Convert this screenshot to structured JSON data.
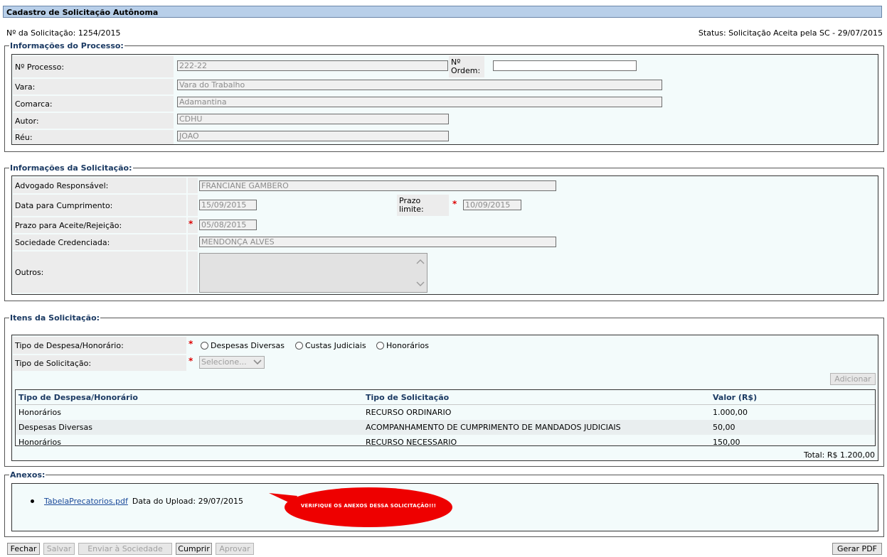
{
  "title": "Cadastro de Solicitação Autônoma",
  "header": {
    "solicitacao": "Nº da Solicitação: 1254/2015",
    "status": "Status: Solicitação Aceita pela SC - 29/07/2015"
  },
  "processo": {
    "legend": "Informações do Processo:",
    "fields": {
      "processo_label": "Nº Processo:",
      "processo_value": "222-22",
      "ordem_label_1": "Nº",
      "ordem_label_2": "Ordem:",
      "ordem_value": "",
      "vara_label": "Vara:",
      "vara_value": "Vara do Trabalho",
      "comarca_label": "Comarca:",
      "comarca_value": "Adamantina",
      "autor_label": "Autor:",
      "autor_value": "CDHU",
      "reu_label": "Réu:",
      "reu_value": "JOAO"
    }
  },
  "solicitacao": {
    "legend": "Informações da Solicitação:",
    "advogado_label": "Advogado Responsável:",
    "advogado_value": "FRANCIANE GAMBERO",
    "data_label": "Data para Cumprimento:",
    "data_value": "15/09/2015",
    "prazo_limite_label_1": "Prazo",
    "prazo_limite_label_2": "limite:",
    "prazo_limite_value": "10/09/2015",
    "prazo_aceite_label": "Prazo para Aceite/Rejeição:",
    "prazo_aceite_value": "05/08/2015",
    "sociedade_label": "Sociedade Credenciada:",
    "sociedade_value": "MENDONÇA ALVES",
    "outros_label": "Outros:",
    "outros_value": ""
  },
  "itens": {
    "legend": "Itens da Solicitação:",
    "tipo_despesa_label": "Tipo de Despesa/Honorário:",
    "radio_options": [
      "Despesas Diversas",
      "Custas Judiciais",
      "Honorários"
    ],
    "tipo_solicitacao_label": "Tipo de Solicitação:",
    "select_placeholder": "Selecione...",
    "adicionar_label": "Adicionar",
    "columns": [
      "Tipo de Despesa/Honorário",
      "Tipo de Solicitação",
      "Valor (R$)"
    ],
    "rows": [
      [
        "Honorários",
        "RECURSO ORDINARIO",
        "1.000,00"
      ],
      [
        "Despesas Diversas",
        "ACOMPANHAMENTO DE CUMPRIMENTO DE MANDADOS JUDICIAIS",
        "50,00"
      ],
      [
        "Honorários",
        "RECURSO NECESSARIO",
        "150,00"
      ]
    ],
    "total": "Total: R$ 1.200,00"
  },
  "anexos": {
    "legend": "Anexos:",
    "file_name": "TabelaPrecatorios.pdf",
    "upload_text": "Data do Upload: 29/07/2015",
    "bubble_text": "VERIFIQUE OS ANEXOS DESSA SOLICITAÇÃO!!!",
    "bubble_color": "#ee0000"
  },
  "toolbar": {
    "fechar": "Fechar",
    "salvar": "Salvar",
    "enviar": "Enviar à Sociedade",
    "cumprir": "Cumprir",
    "aprovar": "Aprovar",
    "gerar_pdf": "Gerar PDF"
  }
}
